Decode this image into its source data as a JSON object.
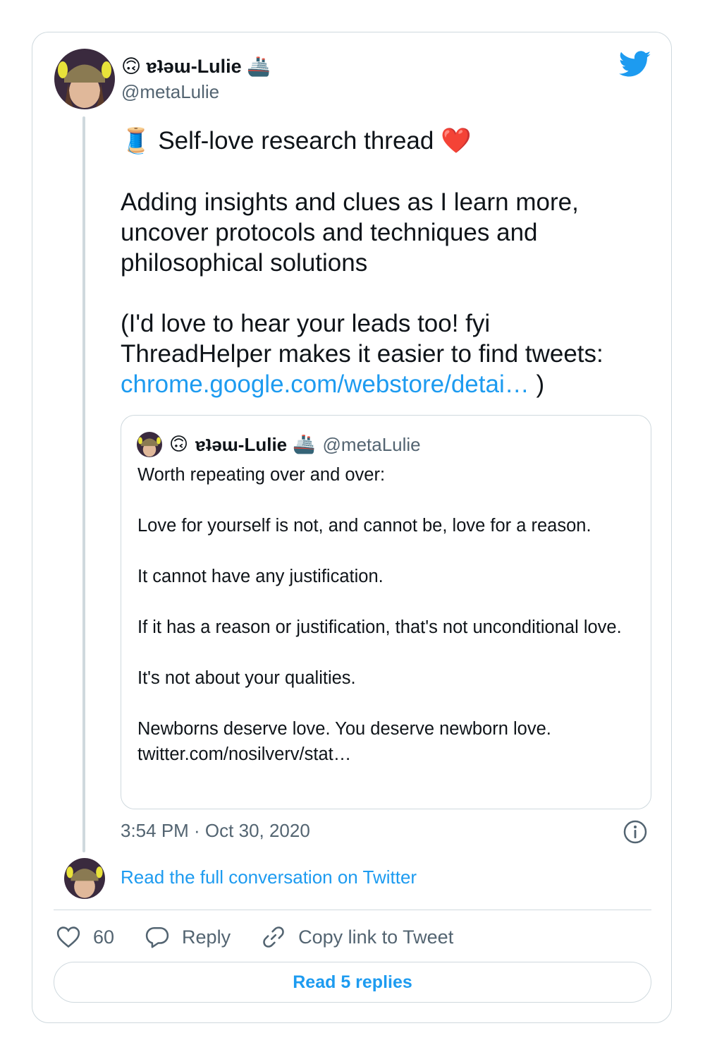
{
  "author": {
    "name_prefix_emoji": "🙃",
    "name": "ɐʇǝɯ-Lulie",
    "name_suffix_emoji": "🚢",
    "handle": "@metaLulie"
  },
  "tweet": {
    "line1_emoji": "🧵",
    "line1_text": "Self-love research thread",
    "line1_heart": "❤️",
    "paragraph2": "Adding insights and clues as I learn more, uncover protocols and techniques and philosophical solutions",
    "paragraph3_text": "(I'd love to hear your leads too! fyi ThreadHelper makes it easier to find tweets: ",
    "paragraph3_link": "chrome.google.com/webstore/detai…",
    "paragraph3_end": " )"
  },
  "quote": {
    "name_prefix_emoji": "🙃",
    "name": "ɐʇǝɯ-Lulie",
    "name_suffix_emoji": "🚢",
    "handle": "@metaLulie",
    "lines": [
      "Worth repeating over and over:",
      "Love for yourself is not, and cannot be, love for a reason.",
      "It cannot have any justification.",
      "If it has a reason or justification, that's not unconditional love.",
      "It's not about your qualities.",
      "Newborns deserve love. You deserve newborn love.",
      "twitter.com/nosilverv/stat…"
    ]
  },
  "timestamp": "3:54 PM · Oct 30, 2020",
  "read_conversation": "Read the full conversation on Twitter",
  "actions": {
    "likes": "60",
    "reply": "Reply",
    "copy_link": "Copy link to Tweet"
  },
  "read_replies": "Read 5 replies",
  "colors": {
    "accent": "#1d9bf0",
    "text": "#0f1419",
    "secondary": "#536471",
    "border": "#cfd9de"
  },
  "icons": [
    "twitter-bird-icon",
    "info-icon",
    "heart-icon",
    "reply-bubble-icon",
    "link-icon"
  ]
}
